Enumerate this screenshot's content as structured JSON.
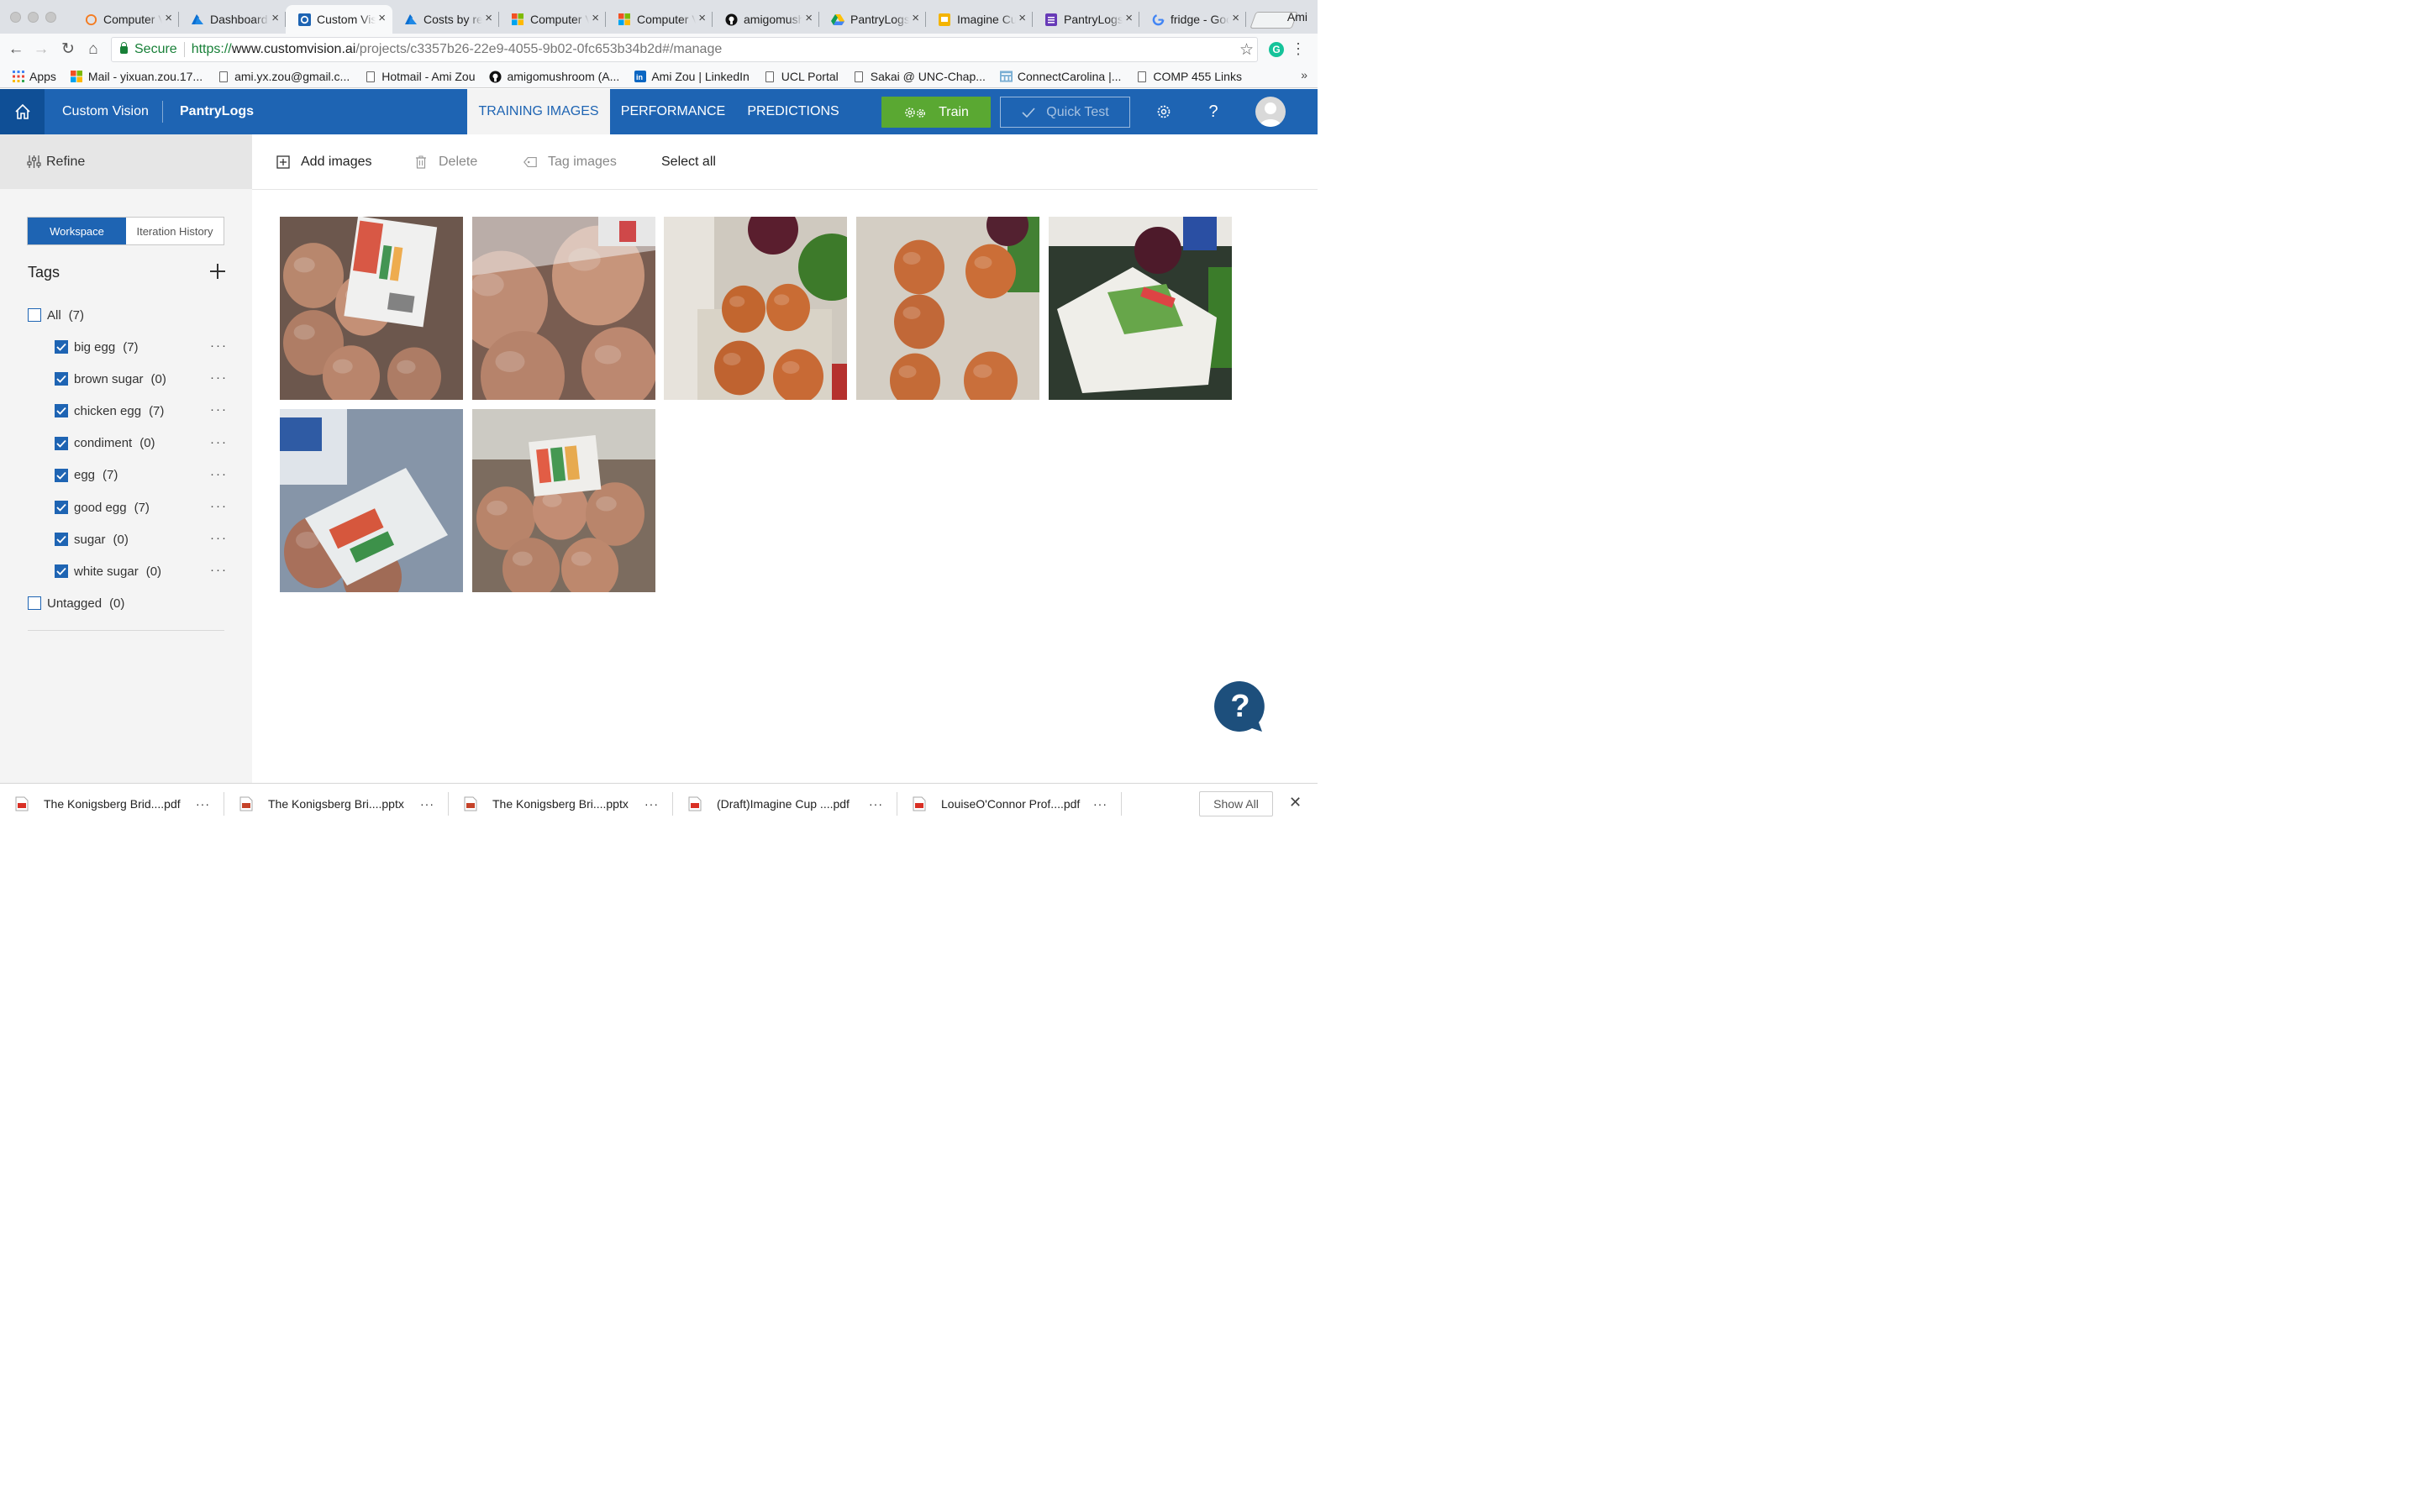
{
  "browser": {
    "tabs": [
      {
        "title": "Computer Vision",
        "icon": "ring"
      },
      {
        "title": "Dashboard - Microsoft Azure",
        "icon": "azure"
      },
      {
        "title": "Custom Vision",
        "icon": "cv",
        "active": true
      },
      {
        "title": "Costs by resource",
        "icon": "azure"
      },
      {
        "title": "Computer Vision",
        "icon": "ms"
      },
      {
        "title": "Computer Vision",
        "icon": "ms"
      },
      {
        "title": "amigomushroom",
        "icon": "github"
      },
      {
        "title": "PantryLogs",
        "icon": "drive"
      },
      {
        "title": "Imagine Cup",
        "icon": "slides"
      },
      {
        "title": "PantryLogs",
        "icon": "forms"
      },
      {
        "title": "fridge - Google",
        "icon": "google"
      }
    ],
    "profile": "Ami",
    "secure_label": "Secure",
    "url": {
      "scheme": "https://",
      "host": "www.customvision.ai",
      "path": "/projects/c3357b26-22e9-4055-9b02-0fc653b34b2d#/manage"
    },
    "bookmarks": [
      {
        "label": "Apps",
        "icon": "apps"
      },
      {
        "label": "Mail - yixuan.zou.17...",
        "icon": "ms"
      },
      {
        "label": "ami.yx.zou@gmail.c...",
        "icon": "page"
      },
      {
        "label": "Hotmail - Ami Zou",
        "icon": "page"
      },
      {
        "label": "amigomushroom (A...",
        "icon": "github"
      },
      {
        "label": "Ami Zou | LinkedIn",
        "icon": "linkedin"
      },
      {
        "label": "UCL Portal",
        "icon": "page"
      },
      {
        "label": "Sakai @ UNC-Chap...",
        "icon": "page"
      },
      {
        "label": "ConnectCarolina |...",
        "icon": "cc"
      },
      {
        "label": "COMP 455 Links",
        "icon": "page"
      }
    ],
    "bookmarks_more": "»"
  },
  "header": {
    "brand": "Custom Vision",
    "project": "PantryLogs",
    "tabs": [
      {
        "label": "TRAINING IMAGES",
        "active": true
      },
      {
        "label": "PERFORMANCE"
      },
      {
        "label": "PREDICTIONS"
      }
    ],
    "train_label": "Train",
    "quick_test_label": "Quick Test"
  },
  "sidebar": {
    "refine_label": "Refine",
    "workspace_label": "Workspace",
    "iteration_label": "Iteration History",
    "tags_title": "Tags",
    "all": {
      "label": "All",
      "count": "(7)"
    },
    "tags": [
      {
        "label": "big egg",
        "count": "(7)"
      },
      {
        "label": "brown sugar",
        "count": "(0)"
      },
      {
        "label": "chicken egg",
        "count": "(7)"
      },
      {
        "label": "condiment",
        "count": "(0)"
      },
      {
        "label": "egg",
        "count": "(7)"
      },
      {
        "label": "good egg",
        "count": "(7)"
      },
      {
        "label": "sugar",
        "count": "(0)"
      },
      {
        "label": "white sugar",
        "count": "(0)"
      }
    ],
    "untagged": {
      "label": "Untagged",
      "count": "(0)"
    },
    "more_label": "···"
  },
  "toolbar": {
    "add_images": "Add images",
    "delete": "Delete",
    "tag_images": "Tag images",
    "select_all": "Select all"
  },
  "images": [
    {
      "scene": "carton-label"
    },
    {
      "scene": "carton-closeup"
    },
    {
      "scene": "tray-onion"
    },
    {
      "scene": "tray-four"
    },
    {
      "scene": "closed-carton"
    },
    {
      "scene": "pack-bottle"
    },
    {
      "scene": "pack-front"
    }
  ],
  "downloads": [
    {
      "name": "The Konigsberg Brid....pdf",
      "type": "pdf"
    },
    {
      "name": "The Konigsberg Bri....pptx",
      "type": "pptx"
    },
    {
      "name": "The Konigsberg Bri....pptx",
      "type": "pptx"
    },
    {
      "name": "(Draft)Imagine Cup ....pdf",
      "type": "pdf"
    },
    {
      "name": "LouiseO'Connor Prof....pdf",
      "type": "pdf"
    }
  ],
  "downloads_more": "···",
  "show_all_label": "Show All",
  "colors": {
    "header_blue": "#1e64b3",
    "home_blue": "#0f4f96",
    "train_green": "#5aa832",
    "help_blue": "#1d4f7c"
  }
}
